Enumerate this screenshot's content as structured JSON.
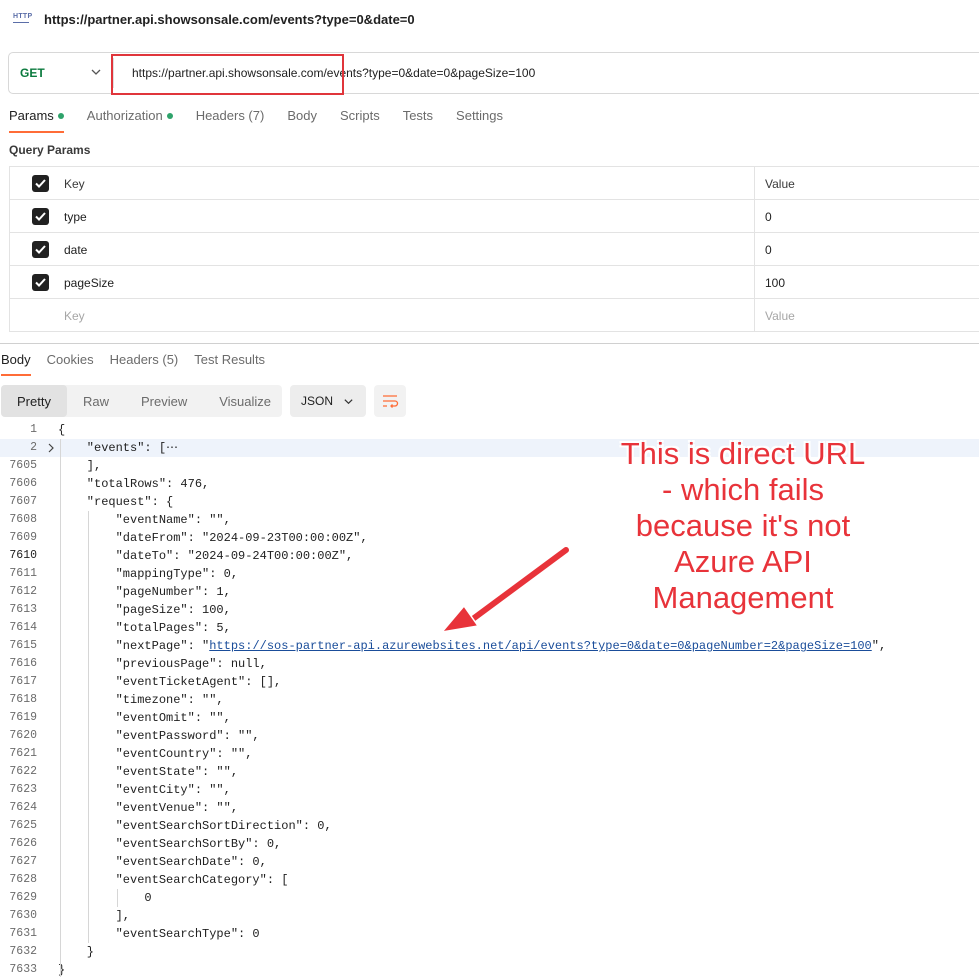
{
  "window": {
    "title": "https://partner.api.showsonsale.com/events?type=0&date=0",
    "icon_label": "HTTP"
  },
  "request": {
    "method": "GET",
    "url": "https://partner.api.showsonsale.com/events?type=0&date=0&pageSize=100"
  },
  "request_tabs": [
    "Params",
    "Authorization",
    "Headers (7)",
    "Body",
    "Scripts",
    "Tests",
    "Settings"
  ],
  "query_params": {
    "label": "Query Params",
    "header_key": "Key",
    "header_value": "Value",
    "rows": [
      {
        "key": "type",
        "value": "0"
      },
      {
        "key": "date",
        "value": "0"
      },
      {
        "key": "pageSize",
        "value": "100"
      }
    ],
    "placeholder_key": "Key",
    "placeholder_value": "Value"
  },
  "response_tabs": [
    "Body",
    "Cookies",
    "Headers (5)",
    "Test Results"
  ],
  "view_modes": [
    "Pretty",
    "Raw",
    "Preview",
    "Visualize"
  ],
  "format": "JSON",
  "code_lines": [
    {
      "n": "1",
      "t": "{"
    },
    {
      "n": "2",
      "t": "    \"events\": [⋯"
    },
    {
      "n": "7605",
      "t": "    ],"
    },
    {
      "n": "7606",
      "t": "    \"totalRows\": 476,"
    },
    {
      "n": "7607",
      "t": "    \"request\": {"
    },
    {
      "n": "7608",
      "t": "        \"eventName\": \"\","
    },
    {
      "n": "7609",
      "t": "        \"dateFrom\": \"2024-09-23T00:00:00Z\","
    },
    {
      "n": "7610",
      "t": "        \"dateTo\": \"2024-09-24T00:00:00Z\","
    },
    {
      "n": "7611",
      "t": "        \"mappingType\": 0,"
    },
    {
      "n": "7612",
      "t": "        \"pageNumber\": 1,"
    },
    {
      "n": "7613",
      "t": "        \"pageSize\": 100,"
    },
    {
      "n": "7614",
      "t": "        \"totalPages\": 5,"
    },
    {
      "n": "7615",
      "t": "        \"nextPage\": \"https://sos-partner-api.azurewebsites.net/api/events?type=0&date=0&pageNumber=2&pageSize=100\","
    },
    {
      "n": "7616",
      "t": "        \"previousPage\": null,"
    },
    {
      "n": "7617",
      "t": "        \"eventTicketAgent\": [],"
    },
    {
      "n": "7618",
      "t": "        \"timezone\": \"\","
    },
    {
      "n": "7619",
      "t": "        \"eventOmit\": \"\","
    },
    {
      "n": "7620",
      "t": "        \"eventPassword\": \"\","
    },
    {
      "n": "7621",
      "t": "        \"eventCountry\": \"\","
    },
    {
      "n": "7622",
      "t": "        \"eventState\": \"\","
    },
    {
      "n": "7623",
      "t": "        \"eventCity\": \"\","
    },
    {
      "n": "7624",
      "t": "        \"eventVenue\": \"\","
    },
    {
      "n": "7625",
      "t": "        \"eventSearchSortDirection\": 0,"
    },
    {
      "n": "7626",
      "t": "        \"eventSearchSortBy\": 0,"
    },
    {
      "n": "7627",
      "t": "        \"eventSearchDate\": 0,"
    },
    {
      "n": "7628",
      "t": "        \"eventSearchCategory\": ["
    },
    {
      "n": "7629",
      "t": "            0"
    },
    {
      "n": "7630",
      "t": "        ],"
    },
    {
      "n": "7631",
      "t": "        \"eventSearchType\": 0"
    },
    {
      "n": "7632",
      "t": "    }"
    },
    {
      "n": "7633",
      "t": "}"
    }
  ],
  "annotation": {
    "text_lines": [
      "This is direct URL",
      "- which fails",
      "because it's not",
      "Azure API",
      "Management"
    ],
    "color": "#e8333a"
  },
  "colors": {
    "accent": "#ff6c37",
    "method_get": "#0b7a3e",
    "highlight_box": "#e0353b",
    "status_dot": "#2fa36b"
  }
}
